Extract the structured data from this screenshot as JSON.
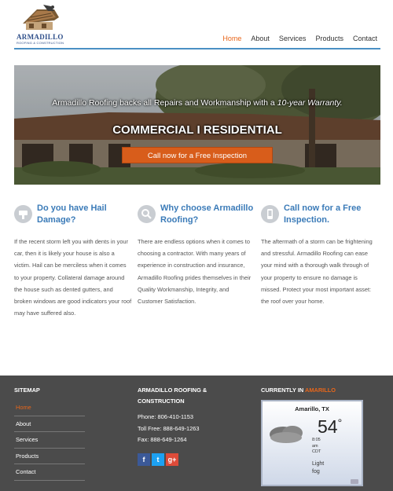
{
  "brand": {
    "name": "ARMADILLO",
    "tagline": "ROOFING & CONSTRUCTION"
  },
  "nav": {
    "items": [
      {
        "label": "Home",
        "active": true
      },
      {
        "label": "About",
        "active": false
      },
      {
        "label": "Services",
        "active": false
      },
      {
        "label": "Products",
        "active": false
      },
      {
        "label": "Contact",
        "active": false
      }
    ]
  },
  "hero": {
    "headline_prefix": "Armadillo Roofing backs all Repairs and Workmanship with a ",
    "headline_emphasis": "10-year Warranty.",
    "subhead": "COMMERCIAL I RESIDENTIAL",
    "cta_label": "Call now for a Free Inspection"
  },
  "features": [
    {
      "icon": "tool-icon",
      "title": "Do you have Hail Damage?",
      "body": "If the recent storm left you with dents in your car, then it is likely your house is also a victim. Hail can be merciless when it comes to your property. Collateral damage around the house such as dented gutters, and broken windows are good indicators your roof may have suffered also."
    },
    {
      "icon": "search-icon",
      "title": "Why choose Armadillo Roofing?",
      "body": "There are endless options when it comes to choosing a contractor. With many years of experience in construction and insurance, Armadillo Roofing prides themselves in their Quality Workmanship, Integrity, and Customer Satisfaction."
    },
    {
      "icon": "phone-icon",
      "title": "Call now for a Free Inspection.",
      "body": "The aftermath of a storm can be frightening and stressful. Armadillo Roofing can ease your mind with a thorough walk through of your property to ensure no damage is missed. Protect your most important asset: the roof over your home."
    }
  ],
  "footer": {
    "sitemap_title": "SITEMAP",
    "sitemap_links": [
      {
        "label": "Home",
        "active": true
      },
      {
        "label": "About",
        "active": false
      },
      {
        "label": "Services",
        "active": false
      },
      {
        "label": "Products",
        "active": false
      },
      {
        "label": "Contact",
        "active": false
      }
    ],
    "company_title_1": "ARMADILLO ROOFING &",
    "company_title_2": "CONSTRUCTION",
    "phone": "Phone: 806-410-1153",
    "toll_free": "Toll Free: 888-649-1263",
    "fax": "Fax: 888-649-1264",
    "social_icons": [
      "facebook-icon",
      "twitter-icon",
      "google-plus-icon"
    ],
    "weather_title_prefix": "CURRENTLY IN ",
    "weather_title_city": "AMARILLO",
    "weather": {
      "location": "Amarillo, TX",
      "temperature": "54",
      "degree_symbol": "°",
      "time": "8:05",
      "ampm": "am",
      "timezone": "CDT",
      "condition_1": "Light",
      "condition_2": "fog"
    }
  },
  "colors": {
    "accent": "#e8661a",
    "link_blue": "#3b7bb8",
    "footer_bg": "#4b4b4b"
  }
}
